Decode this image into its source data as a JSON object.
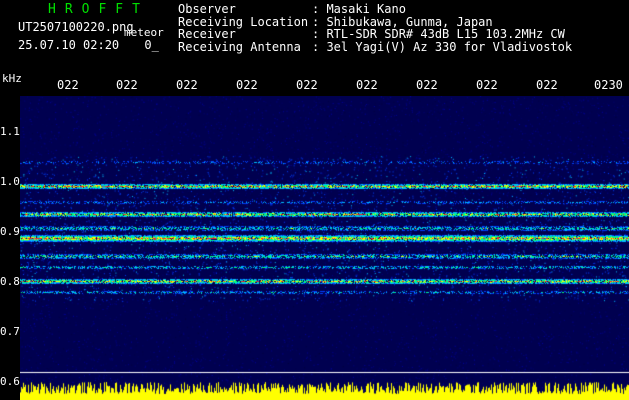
{
  "header": {
    "brand": "HROFFT",
    "filename": "UT2507100220.png",
    "meteor_label": "meteor",
    "datetime": "25.07.10 02:20",
    "count": "0",
    "fields": [
      {
        "label": "Observer",
        "value": ": Masaki Kano"
      },
      {
        "label": "Receiving Location",
        "value": ": Shibukawa, Gunma, Japan"
      },
      {
        "label": "Receiver",
        "value": ": RTL-SDR SDR# 43dB L15 103.2MHz CW"
      },
      {
        "label": "Receiving Antenna",
        "value": ": 3el Yagi(V) Az 330 for Vladivostok"
      }
    ]
  },
  "axis": {
    "unit": "kHz",
    "y_ticks": [
      "1.1",
      "1.0",
      "0.9",
      "0.8",
      "0.7",
      "0.6"
    ],
    "time_ticks": [
      "022",
      "022",
      "022",
      "022",
      "022",
      "022",
      "022",
      "022",
      "022",
      "0230"
    ]
  },
  "colors": {
    "background": "#000000",
    "brand": "#00e000",
    "spectrum_bg": "#000050",
    "signal_levels": [
      "#0040ff",
      "#00c0ff",
      "#00ff80",
      "#ffff00",
      "#ff2020"
    ],
    "power_trace": "#ffff00"
  }
}
